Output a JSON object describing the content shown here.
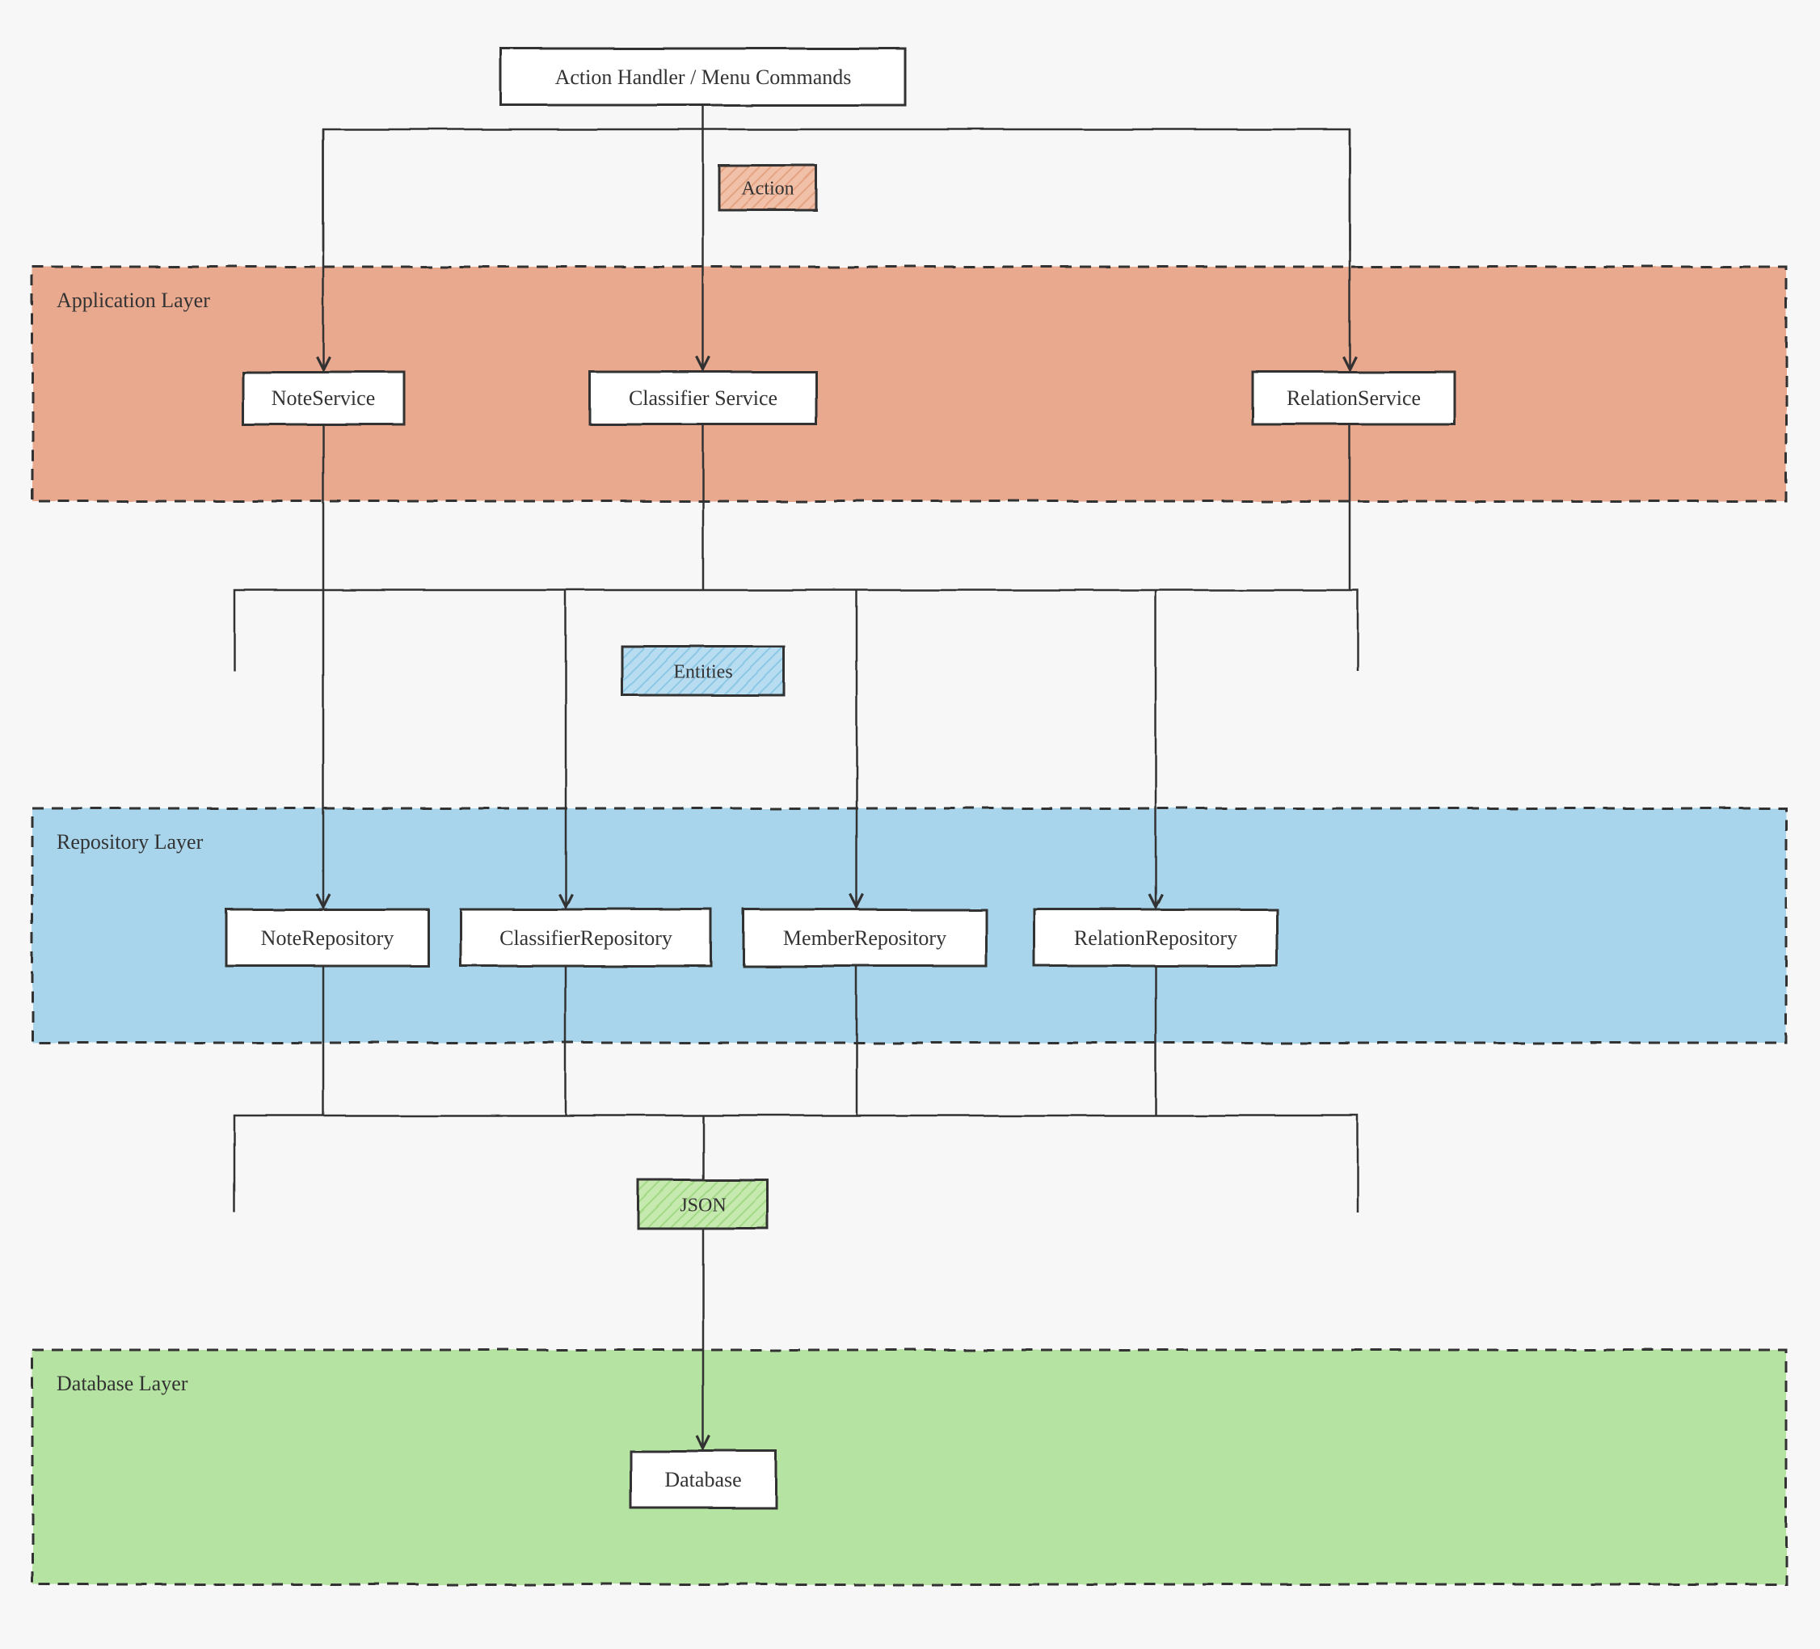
{
  "top_box": "Action Handler / Menu Commands",
  "tags": {
    "action": "Action",
    "entities": "Entities",
    "json": "JSON"
  },
  "layers": {
    "application": "Application Layer",
    "repository": "Repository Layer",
    "database": "Database Layer"
  },
  "services": {
    "note": "NoteService",
    "classifier": "Classifier Service",
    "relation": "RelationService"
  },
  "repositories": {
    "note": "NoteRepository",
    "classifier": "ClassifierRepository",
    "member": "MemberRepository",
    "relation": "RelationRepository"
  },
  "database": "Database",
  "colors": {
    "app_layer": "#e8a98e",
    "repo_layer": "#a8d5eb",
    "db_layer": "#b5e3a1",
    "tag_action_fill": "#e9b29b",
    "tag_entities_fill": "#a0d1e9",
    "tag_json_fill": "#b2e09b",
    "box_fill": "#ffffff",
    "stroke": "#333333"
  }
}
